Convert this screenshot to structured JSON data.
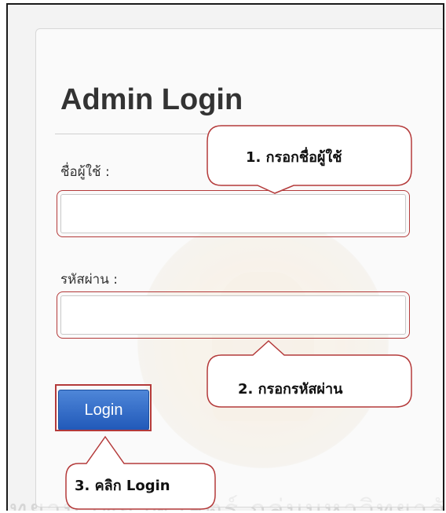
{
  "login_form": {
    "title": "Admin Login",
    "username_label": "ชื่อผู้ใช้ :",
    "username_value": "",
    "password_label": "รหัสผ่าน :",
    "password_value": "",
    "login_button": "Login"
  },
  "annotations": {
    "step1": "1. กรอกชื่อผู้ใช้",
    "step2": "2. กรอกรหัสผ่าน",
    "step3": "3. คลิก Login"
  },
  "background": {
    "footer_watermark": "อุทยานวิทยาศาสตร์ กลุ่มมหาวิทยาลัย"
  },
  "colors": {
    "callout_border": "#b43a3a",
    "button_blue": "#2159b9",
    "title_text": "#333333"
  }
}
